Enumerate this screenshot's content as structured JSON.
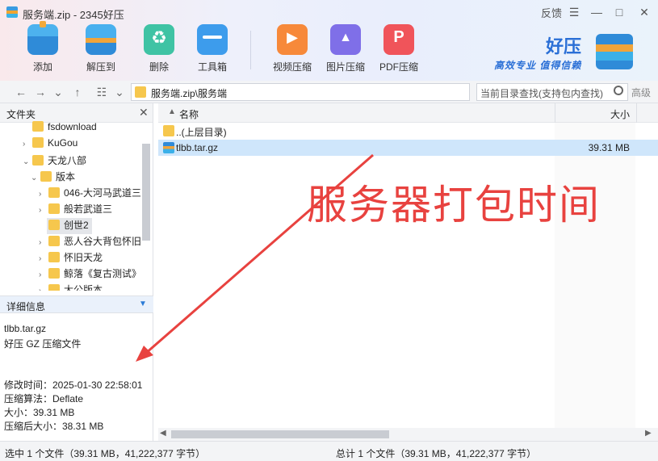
{
  "window": {
    "title": "服务端.zip - 2345好压",
    "feedback": "反馈",
    "menu_glyph": "☰",
    "minimize_glyph": "—",
    "maximize_glyph": "□",
    "close_glyph": "✕"
  },
  "toolbar": {
    "items": [
      {
        "label": "添加",
        "icon": "add-archive-icon"
      },
      {
        "label": "解压到",
        "icon": "extract-icon"
      },
      {
        "label": "删除",
        "icon": "recycle-icon"
      },
      {
        "label": "工具箱",
        "icon": "toolbox-icon"
      },
      {
        "label": "视频压缩",
        "icon": "video-compress-icon"
      },
      {
        "label": "图片压缩",
        "icon": "image-compress-icon"
      },
      {
        "label": "PDF压缩",
        "icon": "pdf-compress-icon"
      }
    ]
  },
  "brand": {
    "name": "好压",
    "slogan": "高效专业 值得信赖"
  },
  "addressbar": {
    "back": "←",
    "forward": "→",
    "dropdown": "⌄",
    "up": "↑",
    "view": "☷",
    "path": "服务端.zip\\服务端",
    "search_placeholder": "当前目录查找(支持包内查找)",
    "advanced": "高级"
  },
  "folder_panel": {
    "title": "文件夹",
    "close": "✕",
    "tree": [
      {
        "label": "fsdownload",
        "arrow": ""
      },
      {
        "label": "KuGou",
        "arrow": "›"
      },
      {
        "label": "天龙八部",
        "arrow": "⌄"
      },
      {
        "label": "版本",
        "arrow": "⌄"
      },
      {
        "label": "046-大河马武道三",
        "arrow": "›"
      },
      {
        "label": "般若武道三",
        "arrow": "›"
      },
      {
        "label": "创世2",
        "arrow": ""
      },
      {
        "label": "恶人谷大背包怀旧",
        "arrow": "›"
      },
      {
        "label": "怀旧天龙",
        "arrow": "›"
      },
      {
        "label": "鲸落《复古测试》",
        "arrow": "›"
      },
      {
        "label": "大公版本",
        "arrow": "›"
      }
    ]
  },
  "details": {
    "title": "详细信息",
    "filename": "tlbb.tar.gz",
    "filetype": "好压 GZ 压缩文件",
    "modified": "修改时间：2025-01-30 22:58:01",
    "algorithm": "压缩算法：Deflate",
    "size": "大小：39.31 MB",
    "packed_size": "压缩后大小：38.31 MB"
  },
  "file_list": {
    "col_name": "名称",
    "col_size": "大小",
    "rows": [
      {
        "name": "..(上层目录)",
        "size": ""
      },
      {
        "name": "tlbb.tar.gz",
        "size": "39.31 MB"
      }
    ]
  },
  "annotation": {
    "text": "服务器打包时间"
  },
  "statusbar": {
    "selected": "选中 1 个文件（39.31 MB，41,222,377 字节）",
    "total": "总计 1 个文件（39.31 MB，41,222,377 字节）"
  },
  "colors": {
    "annotation_red": "#e8423f",
    "brand_blue": "#2a6fd6",
    "selection_blue": "#cfe6fb",
    "folder_yellow": "#f6c74d"
  }
}
